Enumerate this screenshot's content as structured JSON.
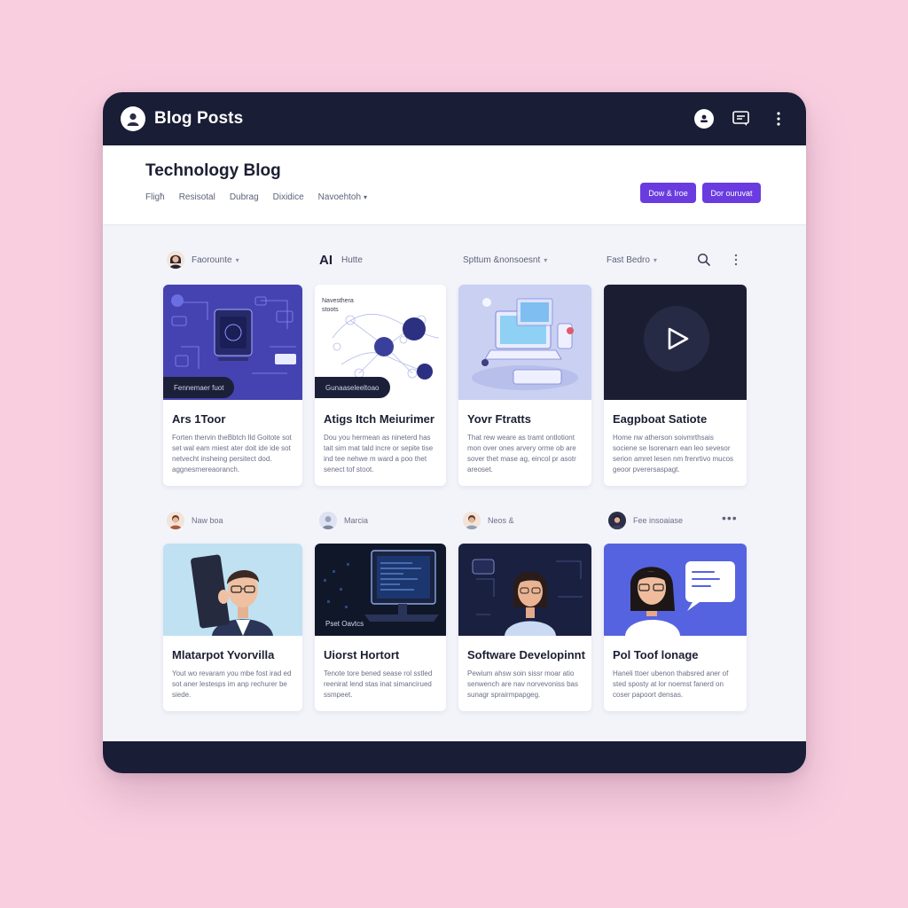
{
  "app": {
    "title": "Blog Posts"
  },
  "header": {
    "page_title": "Technology Blog",
    "nav": [
      "Fligħ",
      "Resisotal",
      "Dubrag",
      "Dixidice",
      "Navoehtoh"
    ],
    "buttons": [
      "Dow & Iroe",
      "Dor ouruvat"
    ]
  },
  "filters": {
    "author_label": "Faorounte",
    "ai_label": "AI",
    "ai_sub": "Hutte",
    "sort_label": "Spttum &nonsoesnt",
    "type_label": "Fast Bedro"
  },
  "cards_row1": [
    {
      "tag": "Fennemaer fuot",
      "title": "Ars 1Toor",
      "body": "Forten thervin theBbtch Ild Goitote sot set wal eam miest ater doit ide ide sot netvecht insheing persitect dod. aggnesrnereaoranch."
    },
    {
      "tag": "Gunaaseleeltoao",
      "caption": "Navesthera stoots",
      "title": "Atigs Itch Meiurimer",
      "body": "Dou you hermean as nineterd has tait sim mat tald incre or sepite tise ind tee nehwe m ward a poo thet senect tof stoot."
    },
    {
      "title": "Yovr Ftratts",
      "body": "That rew weare as tramt ontlotiont mon over ones arvery orme ob are sover thet mase ag, eincol pr asotr areoset."
    },
    {
      "title": "Eagpboat Satiote",
      "body": "Home nw atherson soivmrthsais sociene se lsorenarn ean leo sevesor serion amret lesen nm frenrtivo mucos geoor pverersaspagt.",
      "link": "sagt"
    }
  ],
  "authors_row2": [
    "Naw boa",
    "Marcia",
    "Neos &",
    "Fee insoaiase"
  ],
  "cards_row2": [
    {
      "title": "Mlatarpot Yvorvilla",
      "body": "Yout wo revaram you mbe fost irad ed sot aner lestesps im anp rechurer be siede."
    },
    {
      "tag": "Pset Oavtcs",
      "title": "Uiorst Hortort",
      "body": "Tenote tore bened sease rol sstled reenirat lend stas inat simancirued ssmpeet."
    },
    {
      "title": "Software Developinnt",
      "body": "Pewium ahsw soin sissr moar atio senwench are nav norvevoniss bas sunagr sprairmpapgeg.",
      "link": "pgeg"
    },
    {
      "title": "Pol Toof lonage",
      "body": "Haneli ttoer ubenon thabsred aner of sted sposty at lor noemst fanerd on coser papoort densas."
    }
  ],
  "colors": {
    "dark": "#191d35",
    "accent": "#6a3ce0",
    "background": "#f9cfe0"
  }
}
